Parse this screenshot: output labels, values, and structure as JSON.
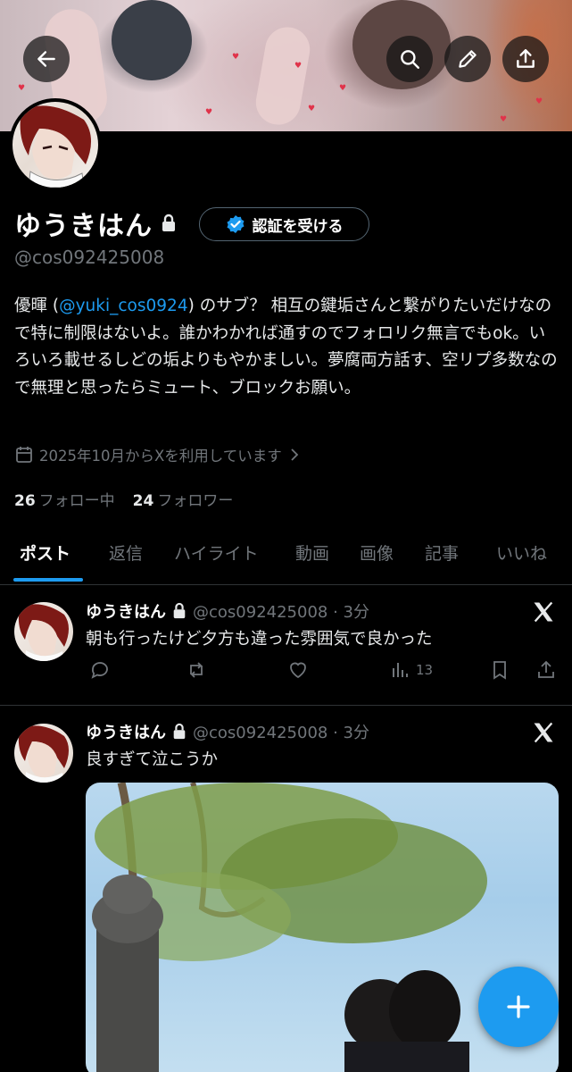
{
  "header": {
    "back_icon": "arrow-left-icon",
    "search_icon": "search-icon",
    "edit_icon": "pencil-icon",
    "share_icon": "share-upload-icon"
  },
  "profile": {
    "display_name": "ゆうきはん",
    "locked": true,
    "verify_button_label": "認証を受ける",
    "handle": "@cos092425008",
    "bio": {
      "before_mention": "優暉 (",
      "mention": "@yuki_cos0924",
      "after_mention": ") のサブ？ 相互の鍵垢さんと繋がりたいだけなので特に制限はないよ。誰かわかれば通すのでフォロリク無言でもok。いろいろ載せるしどの垢よりもやかましい。夢腐両方話す、空リプ多数なので無理と思ったらミュート、ブロックお願い。"
    },
    "joined": "2025年10月からXを利用しています",
    "following_count": "26",
    "following_label": "フォロー中",
    "followers_count": "24",
    "followers_label": "フォロワー"
  },
  "tabs": [
    {
      "label": "ポスト",
      "active": true
    },
    {
      "label": "返信"
    },
    {
      "label": "ハイライト"
    },
    {
      "label": "動画"
    },
    {
      "label": "画像"
    },
    {
      "label": "記事"
    },
    {
      "label": "いいね"
    }
  ],
  "posts": [
    {
      "name": "ゆうきはん",
      "handle_time": "@cos092425008 · 3分",
      "text": "朝も行ったけど夕方も違った雰囲気で良かった",
      "views": "13"
    },
    {
      "name": "ゆうきはん",
      "handle_time": "@cos092425008 · 3分",
      "text": "良すぎて泣こうか"
    }
  ],
  "colors": {
    "accent": "#1d9bf0",
    "background": "#000000",
    "muted_text": "#71767b",
    "divider": "#2f3336"
  }
}
